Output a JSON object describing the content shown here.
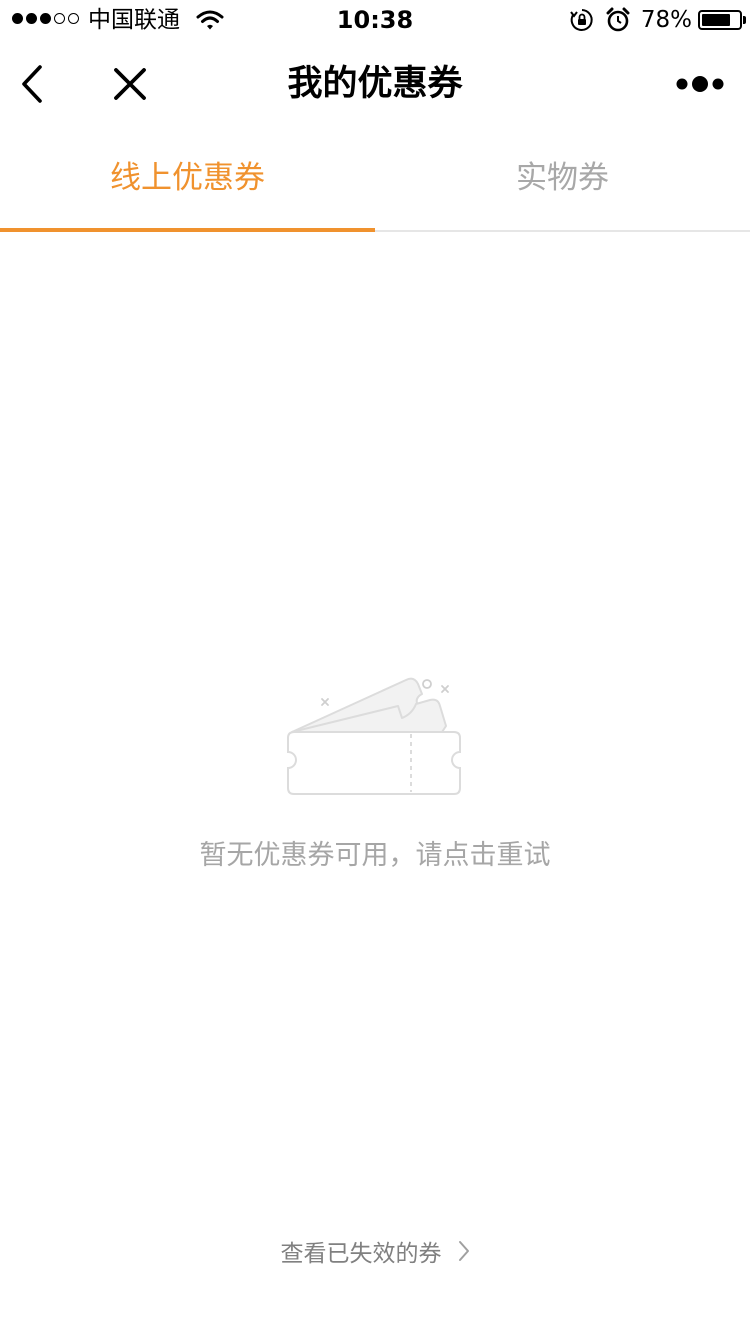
{
  "status_bar": {
    "signal_filled": 3,
    "signal_total": 5,
    "carrier": "中国联通",
    "time": "10:38",
    "battery_pct": "78%",
    "battery_level": 0.78,
    "icons": [
      "wifi-icon",
      "orientation-lock-icon",
      "alarm-icon",
      "battery-icon"
    ]
  },
  "nav": {
    "title": "我的优惠券",
    "icons": [
      "back-arrow-icon",
      "close-icon",
      "more-icon"
    ]
  },
  "tabs": [
    {
      "label": "线上优惠券",
      "active": true
    },
    {
      "label": "实物券",
      "active": false
    }
  ],
  "empty_state": {
    "icon": "coupon-ticket-icon",
    "message": "暂无优惠券可用，请点击重试"
  },
  "footer": {
    "expired_link": "查看已失效的券",
    "icon": "chevron-right-icon"
  },
  "colors": {
    "accent": "#f0922e",
    "inactive_tab": "#a8a8a8",
    "empty_text": "#a6a6a6",
    "footer_text": "#808080",
    "divider": "#e6e6e6",
    "illustration_stroke": "#dcdcdc",
    "illustration_fill": "#f2f2f2"
  }
}
